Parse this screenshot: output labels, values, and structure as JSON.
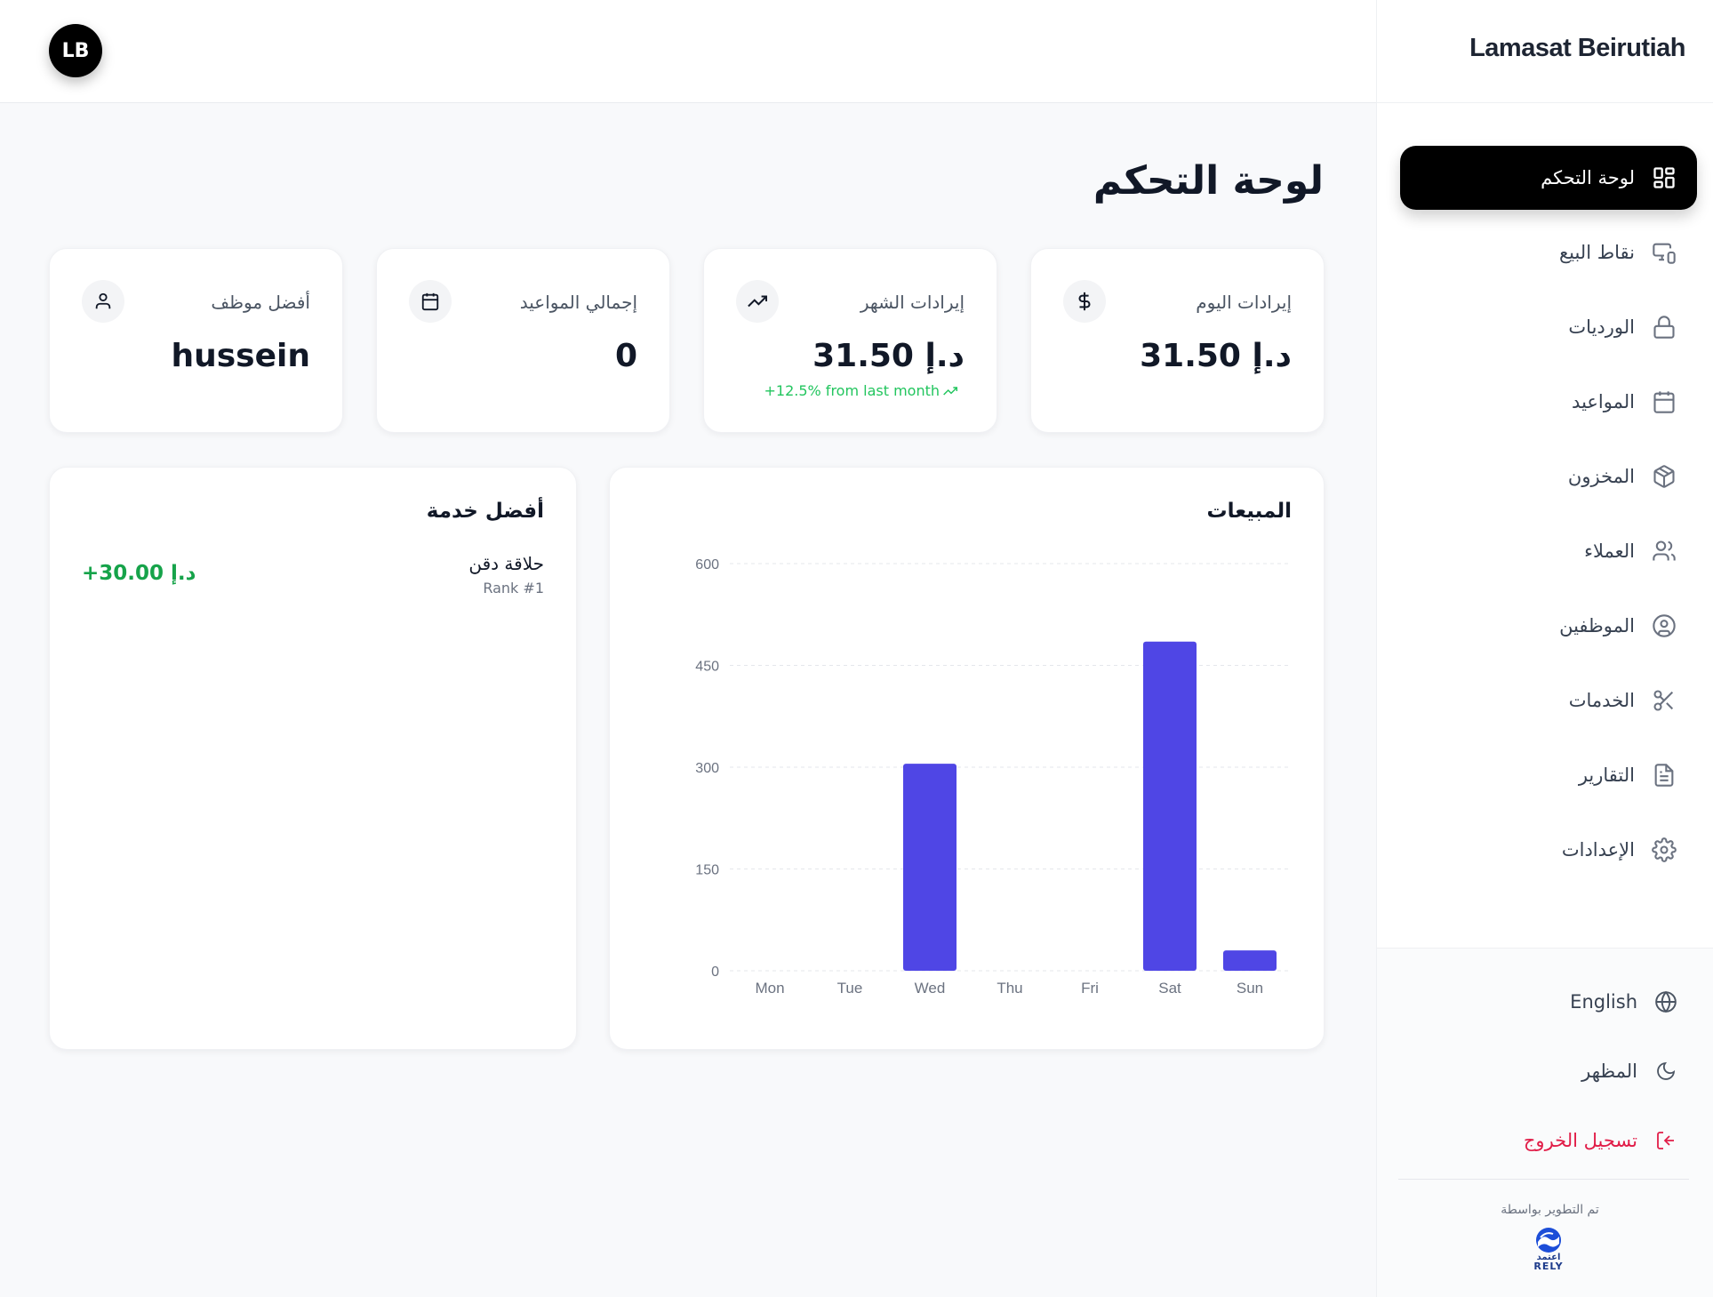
{
  "app": {
    "brand": "Lamasat Beirutiah",
    "user_initials": "LB"
  },
  "page": {
    "title": "لوحة التحكم"
  },
  "sidebar": {
    "items": [
      {
        "label": "لوحة التحكم",
        "icon": "dashboard-grid-icon",
        "active": true
      },
      {
        "label": "نقاط البيع",
        "icon": "pos-devices-icon",
        "active": false
      },
      {
        "label": "الورديات",
        "icon": "lock-icon",
        "active": false
      },
      {
        "label": "المواعيد",
        "icon": "calendar-icon",
        "active": false
      },
      {
        "label": "المخزون",
        "icon": "package-icon",
        "active": false
      },
      {
        "label": "العملاء",
        "icon": "users-icon",
        "active": false
      },
      {
        "label": "الموظفين",
        "icon": "user-circle-icon",
        "active": false
      },
      {
        "label": "الخدمات",
        "icon": "scissors-icon",
        "active": false
      },
      {
        "label": "التقارير",
        "icon": "file-text-icon",
        "active": false
      },
      {
        "label": "الإعدادات",
        "icon": "gear-icon",
        "active": false
      }
    ],
    "bottom": {
      "language": "English",
      "appearance": "المظهر",
      "logout": "تسجيل الخروج",
      "developed_by": "تم التطوير بواسطة",
      "developer_logo_text": "اعتمد",
      "developer_logo_word": "RELY"
    }
  },
  "stats": [
    {
      "label": "إيرادات اليوم",
      "value": "31.50 د.إ",
      "icon": "dollar-icon"
    },
    {
      "label": "إيرادات الشهر",
      "value": "31.50 د.إ",
      "icon": "trending-up-icon",
      "trend": "+12.5% from last month"
    },
    {
      "label": "إجمالي المواعيد",
      "value": "0",
      "icon": "calendar-icon"
    },
    {
      "label": "أفضل موظف",
      "value": "hussein",
      "icon": "user-icon"
    }
  ],
  "sales": {
    "title": "المبيعات"
  },
  "top_service": {
    "title": "أفضل خدمة",
    "name": "حلاقة دقن",
    "rank": "Rank #1",
    "amount": "+30.00 د.إ"
  },
  "colors": {
    "accent": "#4f46e5",
    "positive": "#16a34a",
    "danger": "#e11d48",
    "active_bg": "#000000"
  },
  "chart_data": {
    "type": "bar",
    "categories": [
      "Mon",
      "Tue",
      "Wed",
      "Thu",
      "Fri",
      "Sat",
      "Sun"
    ],
    "values": [
      0,
      0,
      305,
      0,
      0,
      485,
      30
    ],
    "yticks": [
      0,
      150,
      300,
      450,
      600
    ],
    "ylim": [
      0,
      600
    ],
    "grid": true,
    "color": "#4f46e5"
  }
}
